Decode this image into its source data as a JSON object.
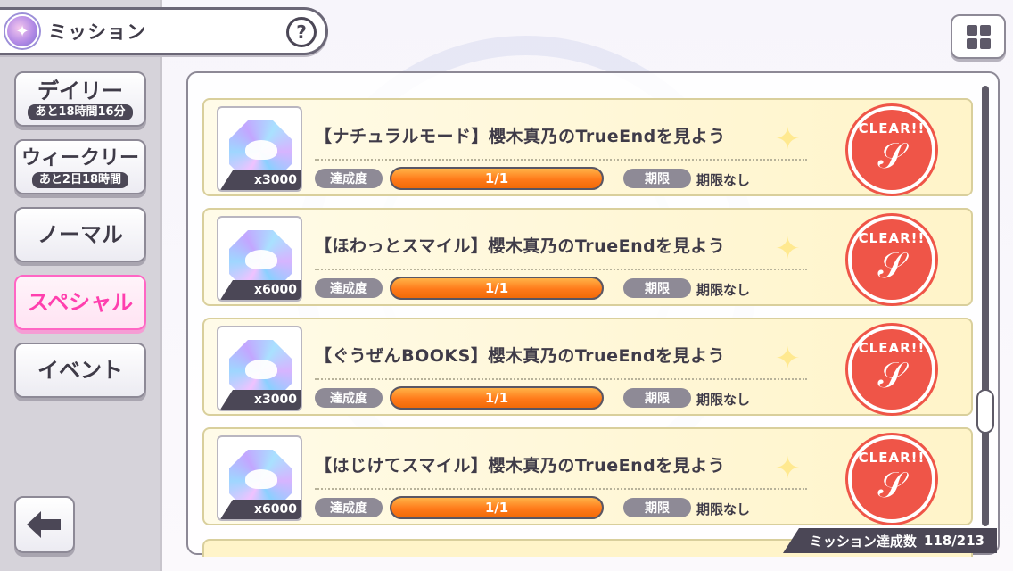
{
  "header": {
    "title": "ミッション",
    "help_label": "?"
  },
  "tabs": [
    {
      "label": "デイリー",
      "sub": "あと18時間16分",
      "active": false
    },
    {
      "label": "ウィークリー",
      "sub": "あと2日18時間",
      "active": false
    },
    {
      "label": "ノーマル",
      "sub": "",
      "active": false
    },
    {
      "label": "スペシャル",
      "sub": "",
      "active": true
    },
    {
      "label": "イベント",
      "sub": "",
      "active": false
    }
  ],
  "missions": [
    {
      "title": "【ナチュラルモード】櫻木真乃のTrueEndを見よう",
      "reward_qty": "x3000",
      "progress_label": "達成度",
      "progress": "1/1",
      "progress_value": 1.0,
      "limit_label": "期限",
      "limit": "期限なし",
      "stamp": "CLEAR!!"
    },
    {
      "title": "【ほわっとスマイル】櫻木真乃のTrueEndを見よう",
      "reward_qty": "x6000",
      "progress_label": "達成度",
      "progress": "1/1",
      "progress_value": 1.0,
      "limit_label": "期限",
      "limit": "期限なし",
      "stamp": "CLEAR!!"
    },
    {
      "title": "【ぐうぜんBOOKS】櫻木真乃のTrueEndを見よう",
      "reward_qty": "x3000",
      "progress_label": "達成度",
      "progress": "1/1",
      "progress_value": 1.0,
      "limit_label": "期限",
      "limit": "期限なし",
      "stamp": "CLEAR!!"
    },
    {
      "title": "【はじけてスマイル】櫻木真乃のTrueEndを見よう",
      "reward_qty": "x6000",
      "progress_label": "達成度",
      "progress": "1/1",
      "progress_value": 1.0,
      "limit_label": "期限",
      "limit": "期限なし",
      "stamp": "CLEAR!!"
    }
  ],
  "footer": {
    "counter_label": "ミッション達成数",
    "counter_value": "118/213"
  },
  "colors": {
    "accent_pink": "#ff3fae",
    "progress_orange": "#ff7a1a",
    "stamp_red": "#ef5548"
  }
}
